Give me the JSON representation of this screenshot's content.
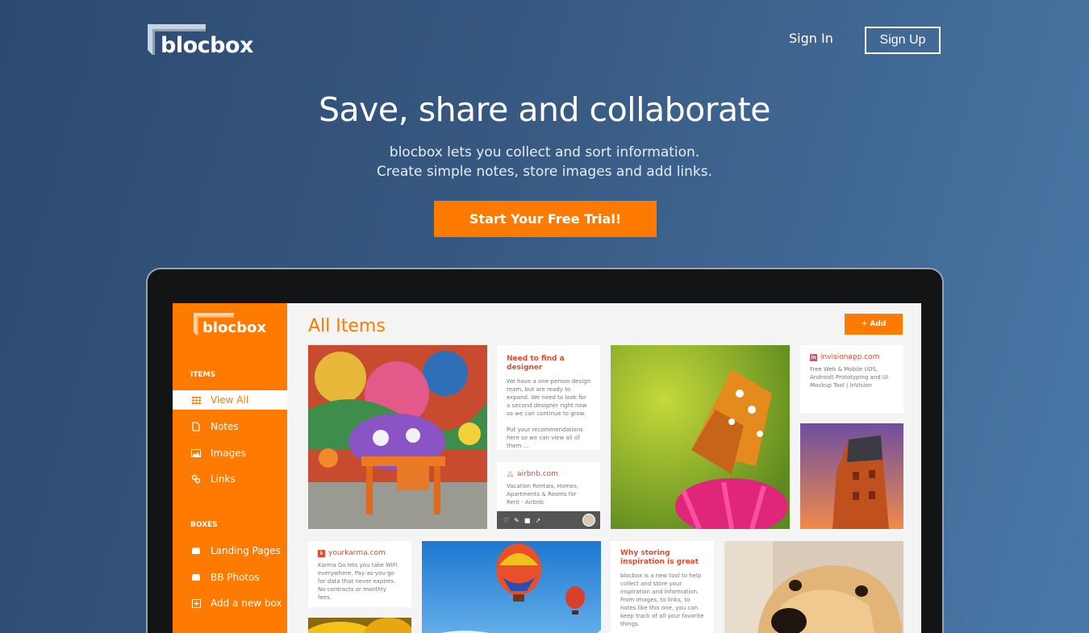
{
  "brand": {
    "name": "blocbox"
  },
  "nav": {
    "signin": "Sign In",
    "signup": "Sign Up"
  },
  "hero": {
    "title": "Save, share and collaborate",
    "subtitle_line1": "blocbox lets you collect and sort information.",
    "subtitle_line2": "Create simple notes, store images and add links.",
    "cta": "Start Your Free Trial!"
  },
  "app": {
    "brand": "blocbox",
    "sidebar": {
      "items_heading": "ITEMS",
      "items": [
        {
          "label": "View All",
          "icon": "grid-icon"
        },
        {
          "label": "Notes",
          "icon": "note-icon"
        },
        {
          "label": "Images",
          "icon": "image-icon"
        },
        {
          "label": "Links",
          "icon": "link-icon"
        }
      ],
      "boxes_heading": "BOXES",
      "boxes": [
        {
          "label": "Landing Pages",
          "icon": "box-icon"
        },
        {
          "label": "BB Photos",
          "icon": "box-icon"
        },
        {
          "label": "Add a new box",
          "icon": "plus-box-icon"
        }
      ]
    },
    "main": {
      "title": "All Items",
      "add_label": "+ Add"
    },
    "cards": {
      "note1": {
        "title": "Need to find a designer",
        "body1": "We have a one-person design team, but are ready to expand. We need to look for a second designer right now so we can continue to grow.",
        "body2": "Put your recommendations here so we can view all of them ..."
      },
      "airbnb": {
        "site": "airbnb.com",
        "desc": "Vacation Rentals, Homes, Apartments & Rooms for Rent - Airbnb"
      },
      "invision": {
        "site": "invisionapp.com",
        "desc": "Free Web & Mobile (iOS, Android) Prototyping and UI Mockup Tool | InVision"
      },
      "karma": {
        "site": "yourkarma.com",
        "desc": "Karma Go lets you take WiFi everywhere. Pay-as-you-go for data that never expires. No contracts or monthly fees."
      },
      "note2": {
        "title": "Why storing inspiration is great",
        "body": "blocbox is a new tool to help collect and store your inspiration and information. From images, to links, to notes like this one, you can keep track of all your favorite things."
      }
    },
    "colors": {
      "accent": "#ff7a00",
      "link_red": "#e54a2f"
    }
  }
}
